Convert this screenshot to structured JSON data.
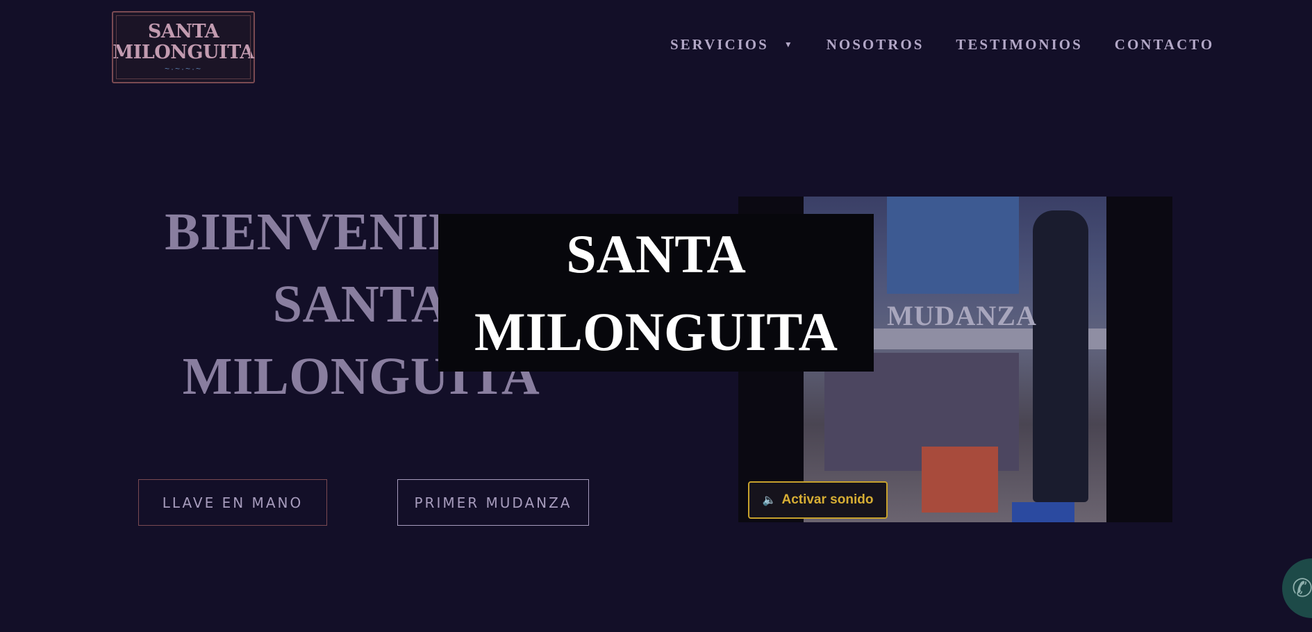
{
  "logo": {
    "line1": "SANTA",
    "line2": "MILONGUITA",
    "ornament": "~·~·~·~"
  },
  "nav": {
    "items": [
      {
        "label": "SERVICIOS",
        "has_dropdown": true
      },
      {
        "label": "NOSOTROS"
      },
      {
        "label": "TESTIMONIOS"
      },
      {
        "label": "CONTACTO"
      }
    ]
  },
  "hero": {
    "title_lines": [
      "BIENVENIDO A",
      "SANTA",
      "MILONGUITA"
    ],
    "overlay_lines": [
      "SANTA",
      "MILONGUITA"
    ],
    "buttons": {
      "llave": "LLAVE EN MANO",
      "primer": "PRIMER MUDANZA"
    }
  },
  "video": {
    "caption": "MUDANZA",
    "sound_button": "Activar sonido",
    "sound_icon": "speaker-icon"
  },
  "floating": {
    "whatsapp_icon": "whatsapp-icon"
  },
  "colors": {
    "background": "#130f28",
    "accent_gold": "#d7ae34",
    "nav_text": "#b3a8c7",
    "hero_text": "#897e9f"
  }
}
